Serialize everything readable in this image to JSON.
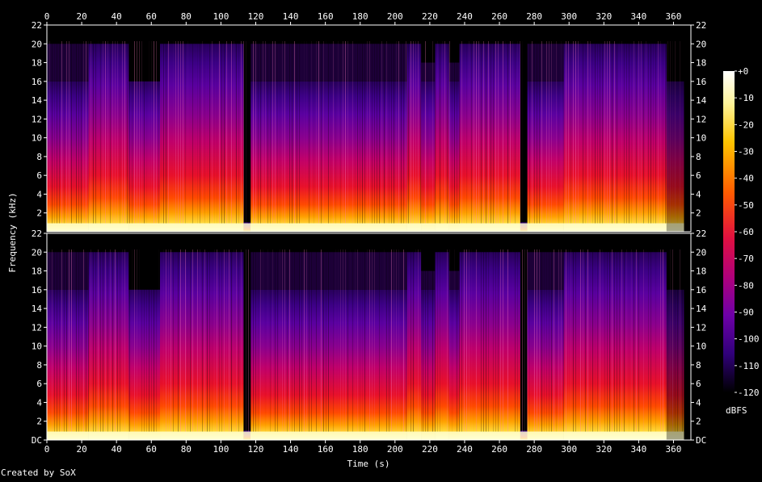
{
  "chart_data": {
    "type": "heatmap",
    "title": "",
    "xlabel": "Time (s)",
    "ylabel": "Frequency (kHz)",
    "xlim": [
      0,
      370
    ],
    "x_ticks": [
      0,
      20,
      40,
      60,
      80,
      100,
      120,
      140,
      160,
      180,
      200,
      220,
      240,
      260,
      280,
      300,
      320,
      340,
      360
    ],
    "channels": [
      {
        "ylim": [
          0,
          22
        ],
        "y_ticks": [
          "2",
          "4",
          "6",
          "8",
          "10",
          "12",
          "14",
          "16",
          "18",
          "20",
          "22"
        ]
      },
      {
        "ylim": [
          0,
          22
        ],
        "y_ticks": [
          "DC",
          "2",
          "4",
          "6",
          "8",
          "10",
          "12",
          "14",
          "16",
          "18",
          "20",
          "22"
        ]
      }
    ],
    "colorbar": {
      "label": "dBFS",
      "range": [
        -120,
        0
      ],
      "ticks": [
        "+0",
        "-10",
        "-20",
        "-30",
        "-40",
        "-50",
        "-60",
        "-70",
        "-80",
        "-90",
        "-100",
        "-110",
        "-120"
      ]
    },
    "segments": [
      {
        "t0": 0,
        "t1": 24,
        "top_khz": 16,
        "sparse_to": 20
      },
      {
        "t0": 24,
        "t1": 47,
        "top_khz": 20,
        "sparse_to": 20
      },
      {
        "t0": 47,
        "t1": 65,
        "top_khz": 16,
        "sparse_to": 16
      },
      {
        "t0": 65,
        "t1": 113,
        "top_khz": 20,
        "sparse_to": 20
      },
      {
        "t0": 113,
        "t1": 117,
        "top_khz": 1,
        "sparse_to": 1
      },
      {
        "t0": 117,
        "t1": 207,
        "top_khz": 16,
        "sparse_to": 20
      },
      {
        "t0": 207,
        "t1": 215,
        "top_khz": 20,
        "sparse_to": 20
      },
      {
        "t0": 215,
        "t1": 223,
        "top_khz": 16,
        "sparse_to": 18
      },
      {
        "t0": 223,
        "t1": 231,
        "top_khz": 20,
        "sparse_to": 20
      },
      {
        "t0": 231,
        "t1": 237,
        "top_khz": 16,
        "sparse_to": 18
      },
      {
        "t0": 237,
        "t1": 272,
        "top_khz": 20,
        "sparse_to": 20
      },
      {
        "t0": 272,
        "t1": 276,
        "top_khz": 1,
        "sparse_to": 1
      },
      {
        "t0": 276,
        "t1": 297,
        "top_khz": 16,
        "sparse_to": 20
      },
      {
        "t0": 297,
        "t1": 356,
        "top_khz": 20,
        "sparse_to": 20
      },
      {
        "t0": 356,
        "t1": 366,
        "top_khz": 16,
        "sparse_to": 16
      }
    ],
    "colors": {
      "background": "#000000",
      "high": "#ffffe0",
      "mid_high": "#ffc800",
      "mid": "#ff3c00",
      "mid_low": "#c8006e",
      "low": "#6e00a0",
      "very_low": "#280064"
    }
  },
  "footer": {
    "credit": "Created by SoX"
  }
}
